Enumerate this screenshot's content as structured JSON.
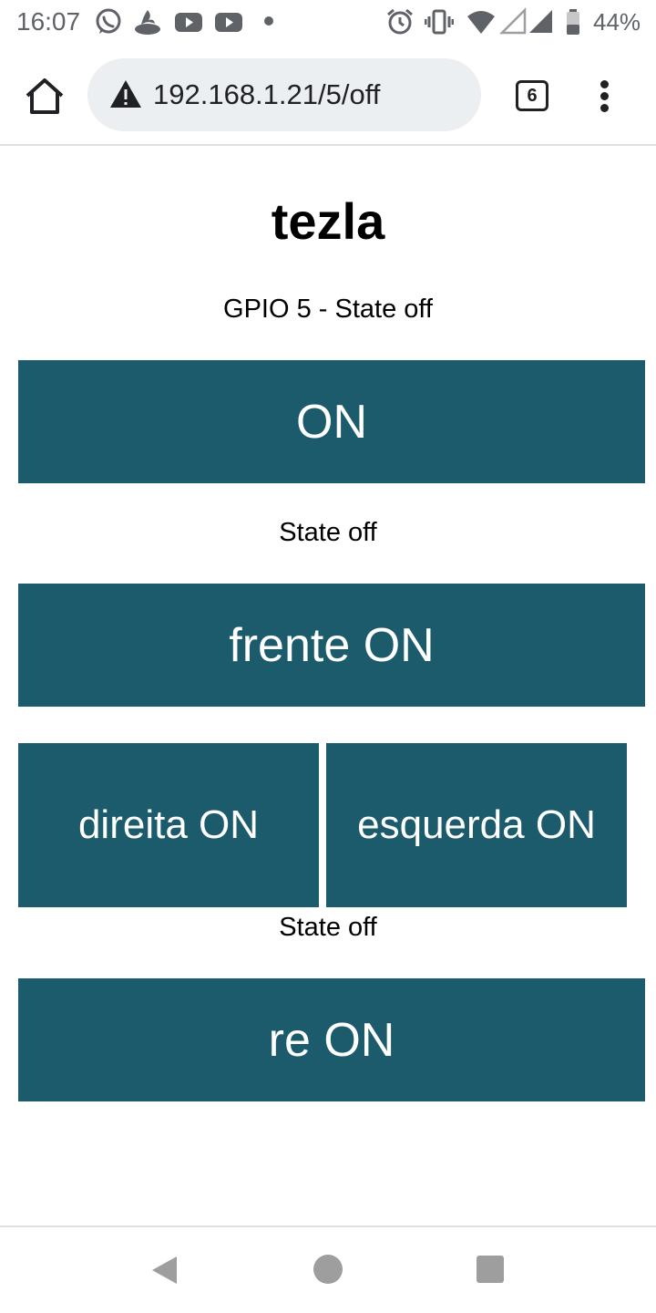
{
  "status_bar": {
    "time": "16:07",
    "notification_icons": [
      "whatsapp-icon",
      "santander-icon",
      "youtube-icon",
      "youtube-icon"
    ],
    "system_icons": [
      "alarm-icon",
      "vibrate-icon",
      "wifi-icon",
      "signal-icon",
      "signal-icon",
      "battery-icon"
    ],
    "battery": "44%"
  },
  "browser": {
    "url": "192.168.1.21/5/off",
    "tab_count": "6",
    "icons": [
      "home-icon",
      "warning-icon",
      "tabs-icon",
      "overflow-menu-icon"
    ]
  },
  "page": {
    "title": "tezla",
    "gpio_state": "GPIO 5 - State off",
    "on_button": "ON",
    "state_1": "State off",
    "frente_button": "frente ON",
    "direita_button": "direita ON",
    "esquerda_button": "esquerda ON",
    "state_2": "State off",
    "re_button": "re ON"
  },
  "colors": {
    "button_bg": "#1c5b6b",
    "button_text": "#ffffff",
    "url_bar_bg": "#eceff1"
  },
  "nav_bar": {
    "icons": [
      "back-icon",
      "home-circle-icon",
      "recents-icon"
    ]
  }
}
